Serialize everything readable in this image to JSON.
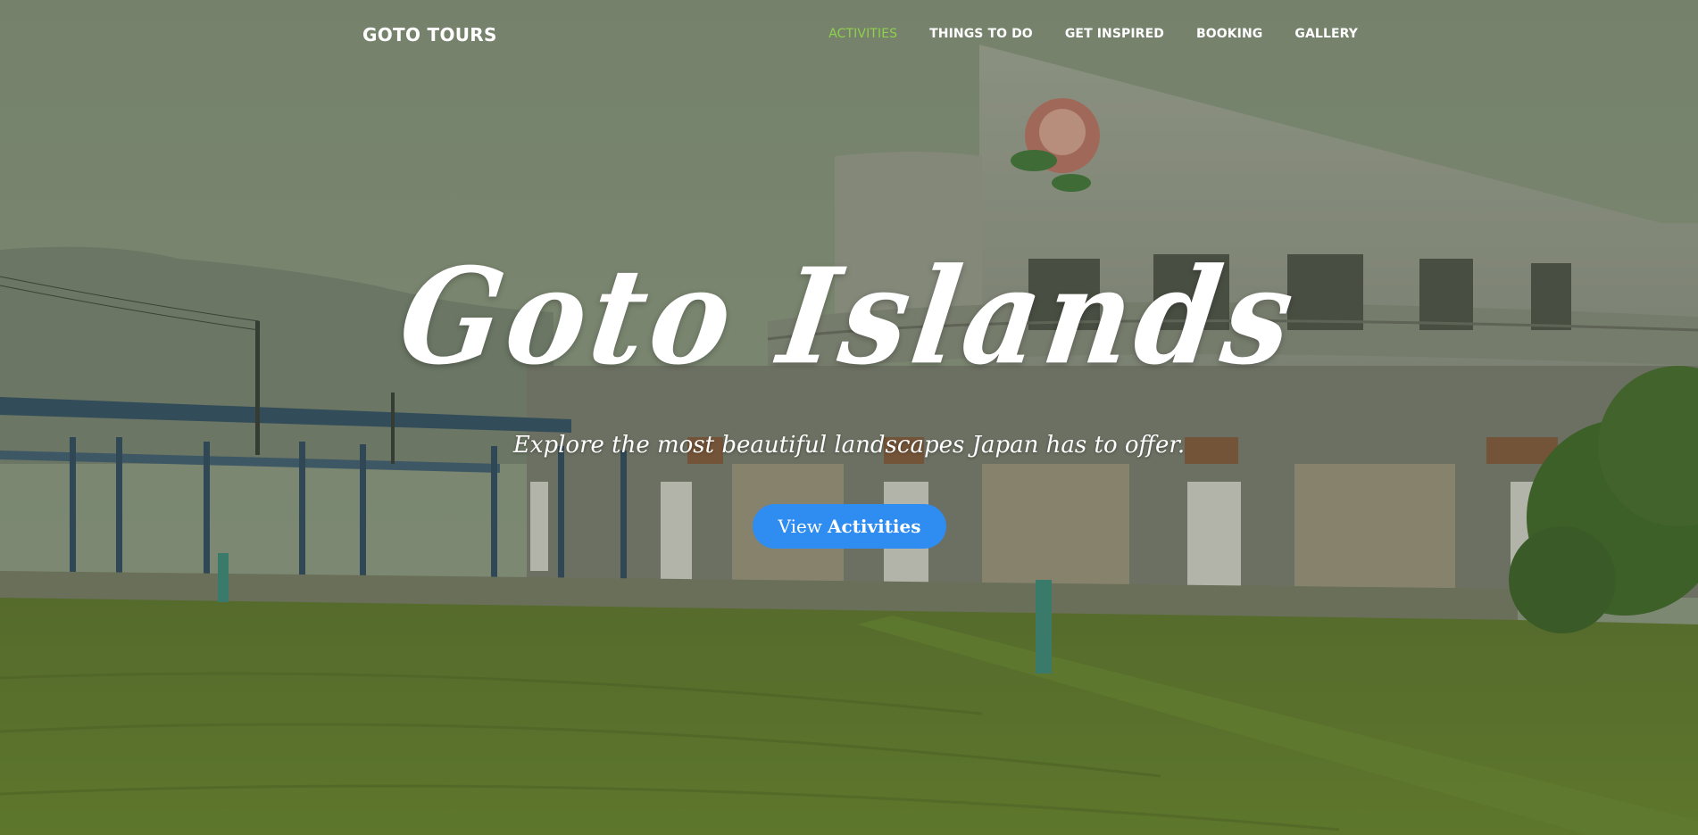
{
  "brand": "GOTO TOURS",
  "nav": {
    "items": [
      {
        "label": "ACTIVITIES",
        "active": true
      },
      {
        "label": "THINGS TO DO"
      },
      {
        "label": "GET INSPIRED"
      },
      {
        "label": "BOOKING"
      },
      {
        "label": "GALLERY"
      }
    ]
  },
  "hero": {
    "title": "Goto Islands",
    "subtitle": "Explore the most beautiful landscapes Japan has to offer.",
    "cta_prefix": "View",
    "cta_strong": "Activities"
  },
  "colors": {
    "accent_active": "#8ed14c",
    "cta_button": "#2f8cf0",
    "text": "#ffffff"
  }
}
